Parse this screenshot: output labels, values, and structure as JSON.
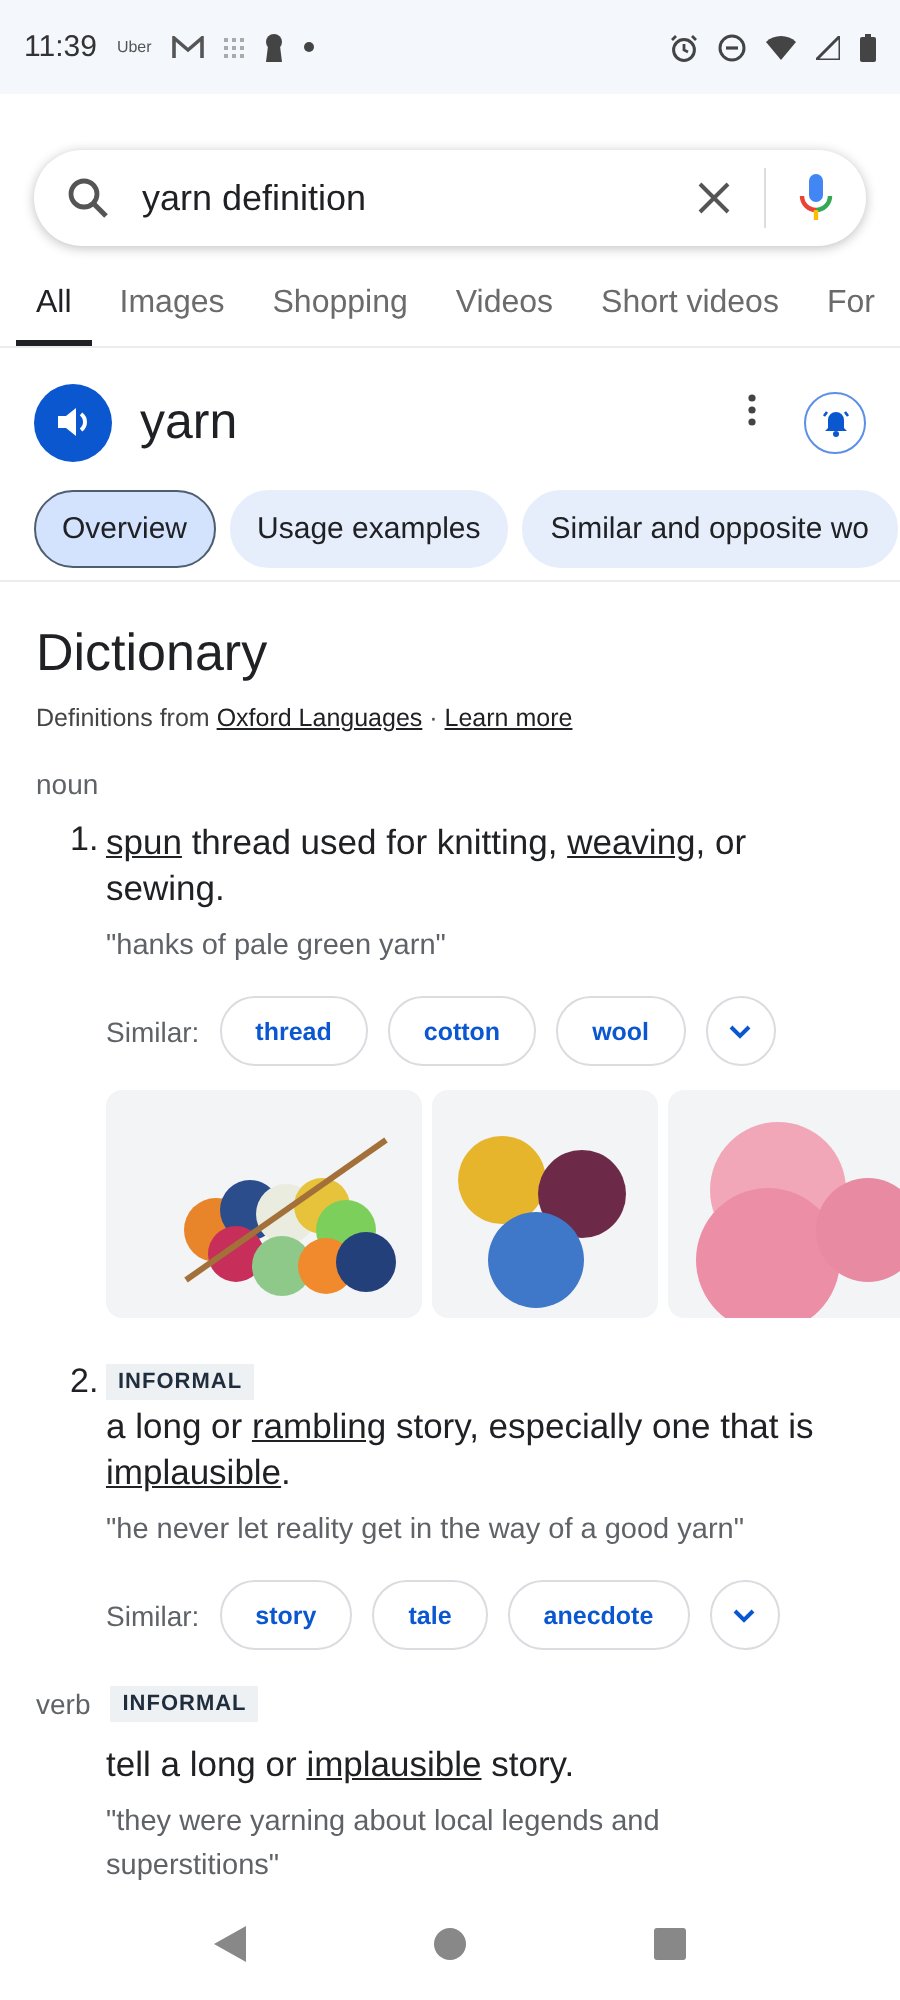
{
  "status_bar": {
    "time": "11:39",
    "app_label": "Uber"
  },
  "search": {
    "value": "yarn definition"
  },
  "tabs": [
    {
      "label": "All",
      "selected": true
    },
    {
      "label": "Images",
      "selected": false
    },
    {
      "label": "Shopping",
      "selected": false
    },
    {
      "label": "Videos",
      "selected": false
    },
    {
      "label": "Short videos",
      "selected": false
    },
    {
      "label": "For",
      "selected": false
    }
  ],
  "word": {
    "headword": "yarn"
  },
  "sections": [
    {
      "label": "Overview",
      "selected": true
    },
    {
      "label": "Usage examples",
      "selected": false
    },
    {
      "label": "Similar and opposite wo",
      "selected": false
    }
  ],
  "dictionary": {
    "title": "Dictionary",
    "source": [
      {
        "text": "Definitions from ",
        "link": false
      },
      {
        "text": "Oxford Languages",
        "link": true
      },
      {
        "text": " · ",
        "link": false
      },
      {
        "text": "Learn more",
        "link": true
      }
    ]
  },
  "entries": [
    {
      "pos": "noun",
      "senses": [
        {
          "number": "1.",
          "parts": [
            {
              "text": "spun",
              "link": true
            },
            {
              "text": " thread used for knitting, ",
              "link": false
            },
            {
              "text": "weaving",
              "link": true
            },
            {
              "text": ", or sewing.",
              "link": false
            }
          ],
          "example": "\"hanks of pale green yarn\"",
          "similar_label": "Similar:",
          "similar": [
            "thread",
            "cotton",
            "wool"
          ],
          "images": [
            {
              "kind": "picture"
            },
            {
              "kind": "picture"
            },
            {
              "kind": "picture"
            }
          ]
        },
        {
          "number": "2.",
          "label": "INFORMAL",
          "parts": [
            {
              "text": "a long or ",
              "link": false
            },
            {
              "text": "rambling",
              "link": true
            },
            {
              "text": " story, especially one that is ",
              "link": false
            },
            {
              "text": "implausible",
              "link": true
            },
            {
              "text": ".",
              "link": false
            }
          ],
          "example": "\"he never let reality get in the way of a good yarn\"",
          "similar_label": "Similar:",
          "similar": [
            "story",
            "tale",
            "anecdote"
          ]
        }
      ]
    },
    {
      "pos": "verb",
      "label": "INFORMAL",
      "senses": [
        {
          "parts": [
            {
              "text": "tell a long or ",
              "link": false
            },
            {
              "text": "implausible",
              "link": true
            },
            {
              "text": " story.",
              "link": false
            }
          ],
          "example": "\"they were yarning about local legends and superstitions\""
        }
      ]
    }
  ]
}
